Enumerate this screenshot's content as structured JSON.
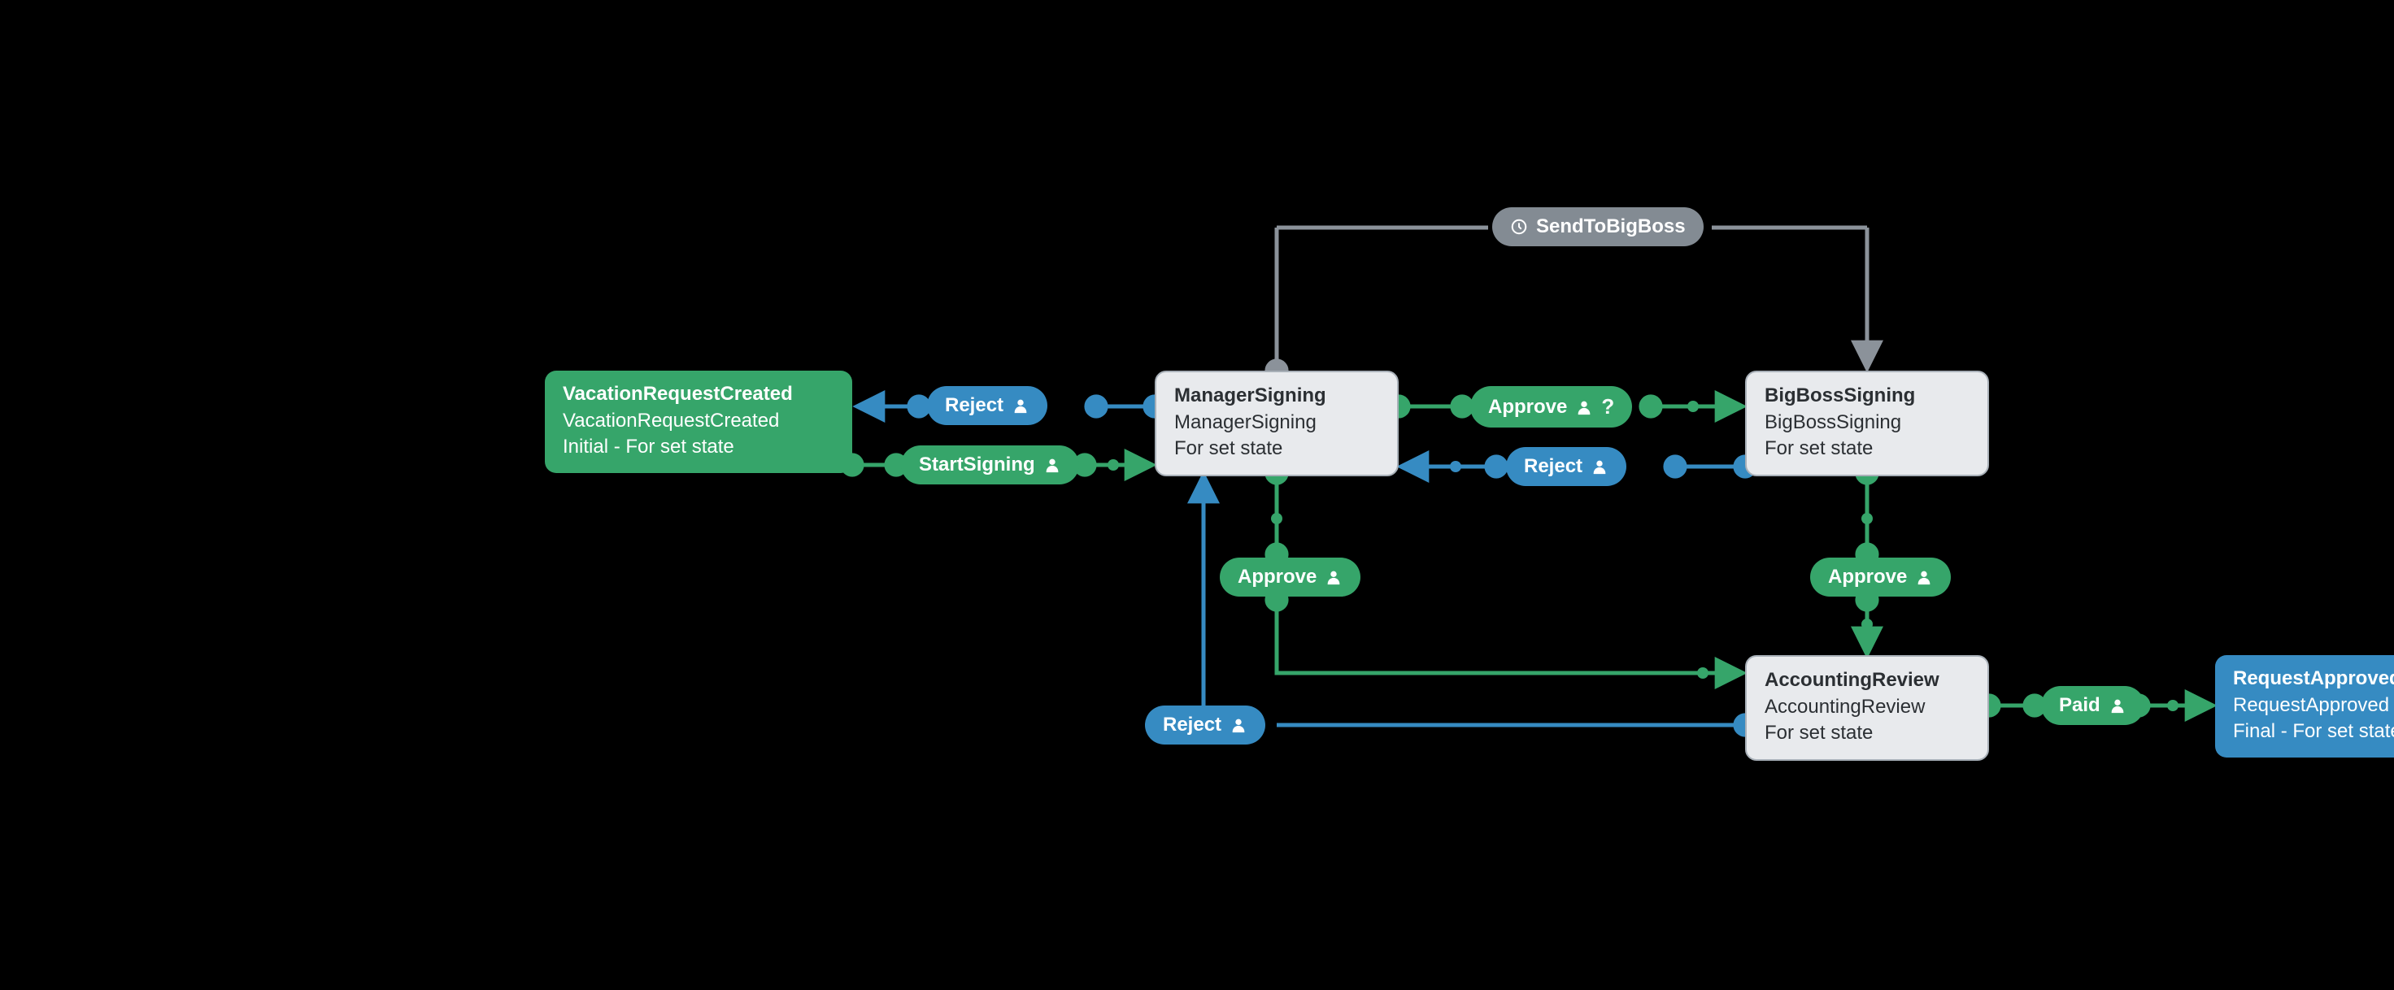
{
  "nodes": {
    "vacation": {
      "title": "VacationRequestCreated",
      "subtitle": "VacationRequestCreated",
      "meta": "Initial - For set state"
    },
    "manager": {
      "title": "ManagerSigning",
      "subtitle": "ManagerSigning",
      "meta": "For set state"
    },
    "bigboss": {
      "title": "BigBossSigning",
      "subtitle": "BigBossSigning",
      "meta": "For set state"
    },
    "accounting": {
      "title": "AccountingReview",
      "subtitle": "AccountingReview",
      "meta": "For set state"
    },
    "approved": {
      "title": "RequestApproved",
      "subtitle": "RequestApproved",
      "meta": "Final - For set state"
    }
  },
  "badges": {
    "reject_mv": "Reject",
    "start": "StartSigning",
    "approve_mb": "Approve",
    "reject_bm": "Reject",
    "approve_ma": "Approve",
    "approve_ba": "Approve",
    "reject_am": "Reject",
    "paid": "Paid",
    "sendbb": "SendToBigBoss"
  },
  "colors": {
    "green": "#36a56a",
    "blue": "#368bc2",
    "grey": "#838b93",
    "edge_grey": "#8b929a"
  }
}
